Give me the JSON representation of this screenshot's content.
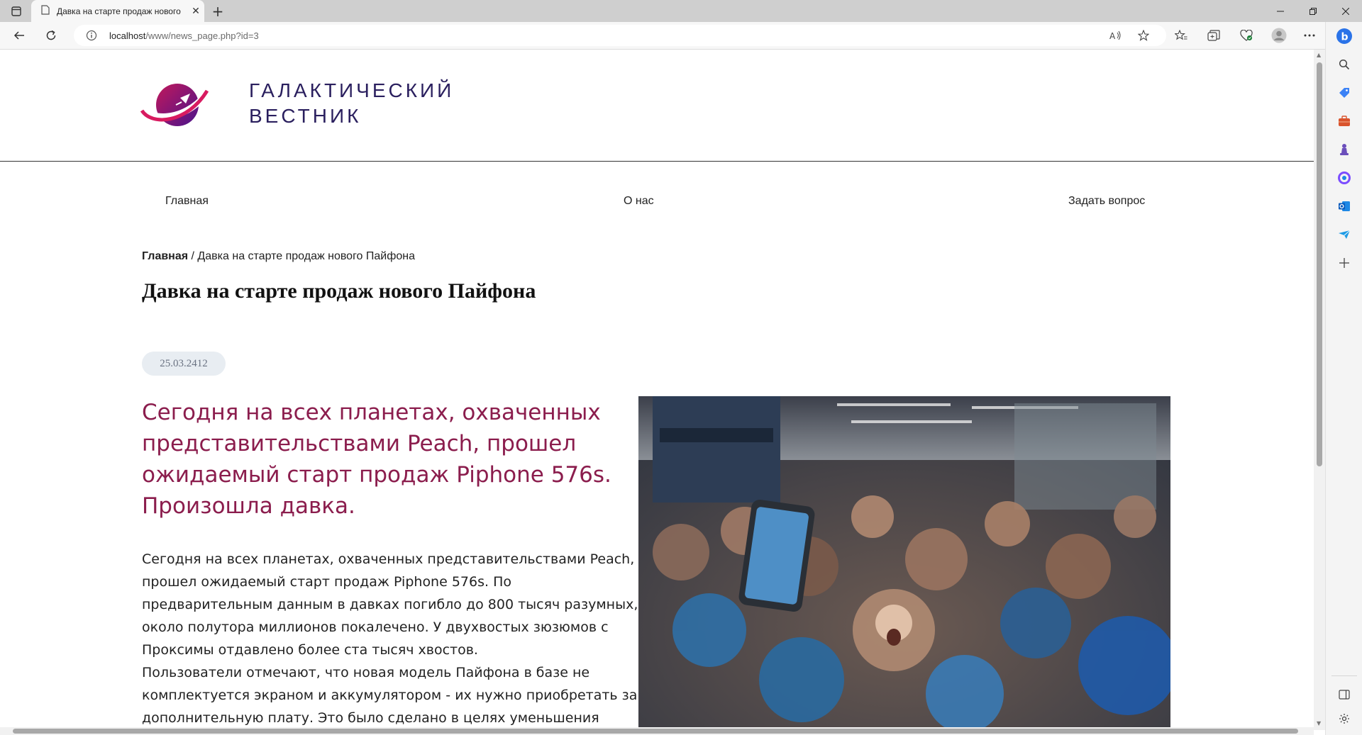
{
  "browser": {
    "tab_title": "Давка на старте продаж нового",
    "url_host": "localhost",
    "url_path": "/www/news_page.php?id=3"
  },
  "site": {
    "title_line1": "ГАЛАКТИЧЕСКИЙ",
    "title_line2": "ВЕСТНИК",
    "nav": [
      "Главная",
      "О нас",
      "Задать вопрос"
    ]
  },
  "article": {
    "breadcrumb_home": "Главная",
    "breadcrumb_sep": " / ",
    "breadcrumb_current": "Давка на старте продаж нового Пайфона",
    "title": "Давка на старте продаж нового Пайфона",
    "date": "25.03.2412",
    "lead": "Сегодня на всех планетах, охваченных представительствами Peach, прошел ожидаемый старт продаж Piphone 576s. Произошла давка.",
    "paragraph1": "Сегодня на всех планетах, охваченных представительствами Peach, прошел ожидаемый старт продаж Piphone 576s. По предварительным данным в давках погибло до 800 тысяч разумных, около полутора миллионов покалечено. У двухвостых зюзюмов с Проксимы отдавлено более ста тысяч хвостов.",
    "paragraph2": "Пользователи отмечают, что новая модель Пайфона в базе не комплектуется экраном и аккумулятором - их нужно приобретать за дополнительную плату. Это было сделано в целях уменьшения"
  },
  "colors": {
    "lead": "#8b1d4d",
    "site_title": "#2a1f5e",
    "date_badge_bg": "#e8edf2"
  }
}
